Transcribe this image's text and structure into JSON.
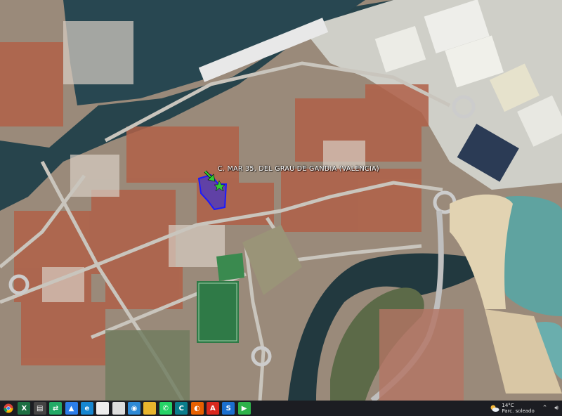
{
  "map": {
    "placemark_label": "C. MAR 35, DEL GRAU DE GANDIA (VALENCIA)",
    "placemark_color": "#1a1aff",
    "pointer_color": "#33cc33"
  },
  "taskbar": {
    "apps": [
      {
        "name": "chrome-icon",
        "glyph": "",
        "bg": "#1c1d22"
      },
      {
        "name": "excel-icon",
        "glyph": "X",
        "bg": "#1d6f42"
      },
      {
        "name": "print-icon",
        "glyph": "▤",
        "bg": "#444"
      },
      {
        "name": "network-icon",
        "glyph": "⇄",
        "bg": "#2a6"
      },
      {
        "name": "photos-icon",
        "glyph": "▲",
        "bg": "#2b7de9"
      },
      {
        "name": "edge-icon",
        "glyph": "e",
        "bg": "#1787d1"
      },
      {
        "name": "document-icon",
        "glyph": "",
        "bg": "#eee"
      },
      {
        "name": "file-icon",
        "glyph": "",
        "bg": "#ddd"
      },
      {
        "name": "app-icon",
        "glyph": "◉",
        "bg": "#2e8ad6"
      },
      {
        "name": "folder-icon",
        "glyph": "",
        "bg": "#e8b52d"
      },
      {
        "name": "whatsapp-icon",
        "glyph": "✆",
        "bg": "#25d366"
      },
      {
        "name": "messenger-icon",
        "glyph": "C",
        "bg": "#0a7d8c"
      },
      {
        "name": "firefox-icon",
        "glyph": "◐",
        "bg": "#e66000"
      },
      {
        "name": "acrobat-icon",
        "glyph": "A",
        "bg": "#d9281e"
      },
      {
        "name": "s-app-icon",
        "glyph": "S",
        "bg": "#1b6fcf"
      },
      {
        "name": "green-app-icon",
        "glyph": "▶",
        "bg": "#2db34a"
      }
    ],
    "weather": {
      "temp": "14°C",
      "condition": "Parc. soleado"
    }
  }
}
